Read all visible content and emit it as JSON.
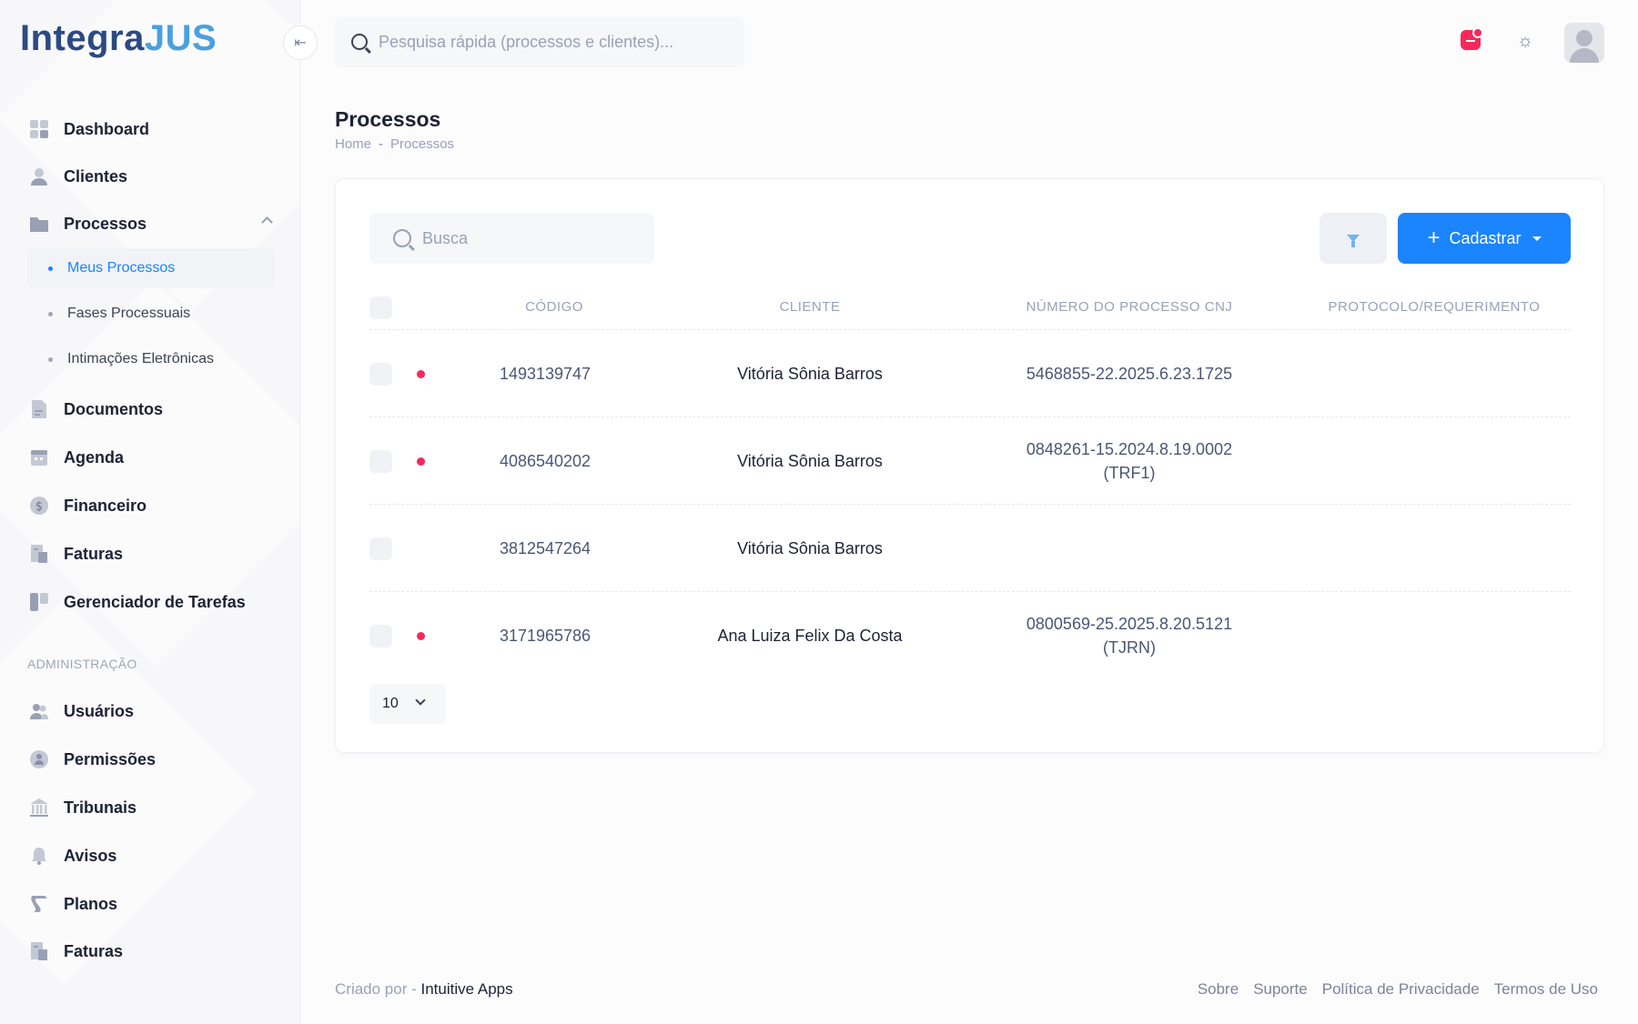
{
  "app": {
    "logo_part1": "Integra",
    "logo_part2": "JUS",
    "brand_color": "#1b84ff"
  },
  "sidebar": {
    "items": [
      {
        "label": "Dashboard",
        "icon": "grid-icon"
      },
      {
        "label": "Clientes",
        "icon": "user-icon"
      },
      {
        "label": "Processos",
        "icon": "folder-icon"
      },
      {
        "label": "Documentos",
        "icon": "document-icon"
      },
      {
        "label": "Agenda",
        "icon": "calendar-icon"
      },
      {
        "label": "Financeiro",
        "icon": "dollar-icon"
      },
      {
        "label": "Faturas",
        "icon": "invoice-icon"
      },
      {
        "label": "Gerenciador de Tarefas",
        "icon": "kanban-icon"
      }
    ],
    "sub_items": [
      {
        "label": "Meus Processos",
        "active": true
      },
      {
        "label": "Fases Processuais",
        "active": false
      },
      {
        "label": "Intimações Eletrônicas",
        "active": false
      }
    ],
    "admin_title": "ADMINISTRAÇÃO",
    "admin_items": [
      {
        "label": "Usuários",
        "icon": "users-icon"
      },
      {
        "label": "Permissões",
        "icon": "shield-icon"
      },
      {
        "label": "Tribunais",
        "icon": "bank-icon"
      },
      {
        "label": "Avisos",
        "icon": "bell-icon"
      },
      {
        "label": "Planos",
        "icon": "scroll-icon"
      },
      {
        "label": "Faturas",
        "icon": "invoice-icon"
      }
    ]
  },
  "header": {
    "search_placeholder": "Pesquisa rápida (processos e clientes)..."
  },
  "page": {
    "title": "Processos",
    "breadcrumb": [
      "Home",
      "Processos"
    ],
    "breadcrumb_sep": "-"
  },
  "card": {
    "search_placeholder": "Busca",
    "add_button": "Cadastrar",
    "columns": [
      "CÓDIGO",
      "CLIENTE",
      "NÚMERO DO PROCESSO CNJ",
      "PROTOCOLO/REQUERIMENTO"
    ],
    "rows": [
      {
        "status_dot": true,
        "code": "1493139747",
        "client": "Vitória Sônia Barros",
        "cnj_line1": "5468855-22.2025.6.23.1725",
        "cnj_line2": ""
      },
      {
        "status_dot": true,
        "code": "4086540202",
        "client": "Vitória Sônia Barros",
        "cnj_line1": "0848261-15.2024.8.19.0002",
        "cnj_line2": "(TRF1)"
      },
      {
        "status_dot": false,
        "code": "3812547264",
        "client": "Vitória Sônia Barros",
        "cnj_line1": "",
        "cnj_line2": ""
      },
      {
        "status_dot": true,
        "code": "3171965786",
        "client": "Ana Luiza Felix Da Costa",
        "cnj_line1": "0800569-25.2025.8.20.5121",
        "cnj_line2": "(TJRN)"
      }
    ],
    "per_page": "10"
  },
  "footer": {
    "created_by": "Criado por -",
    "company": "Intuitive Apps",
    "links": [
      "Sobre",
      "Suporte",
      "Política de Privacidade",
      "Termos de Uso"
    ]
  }
}
